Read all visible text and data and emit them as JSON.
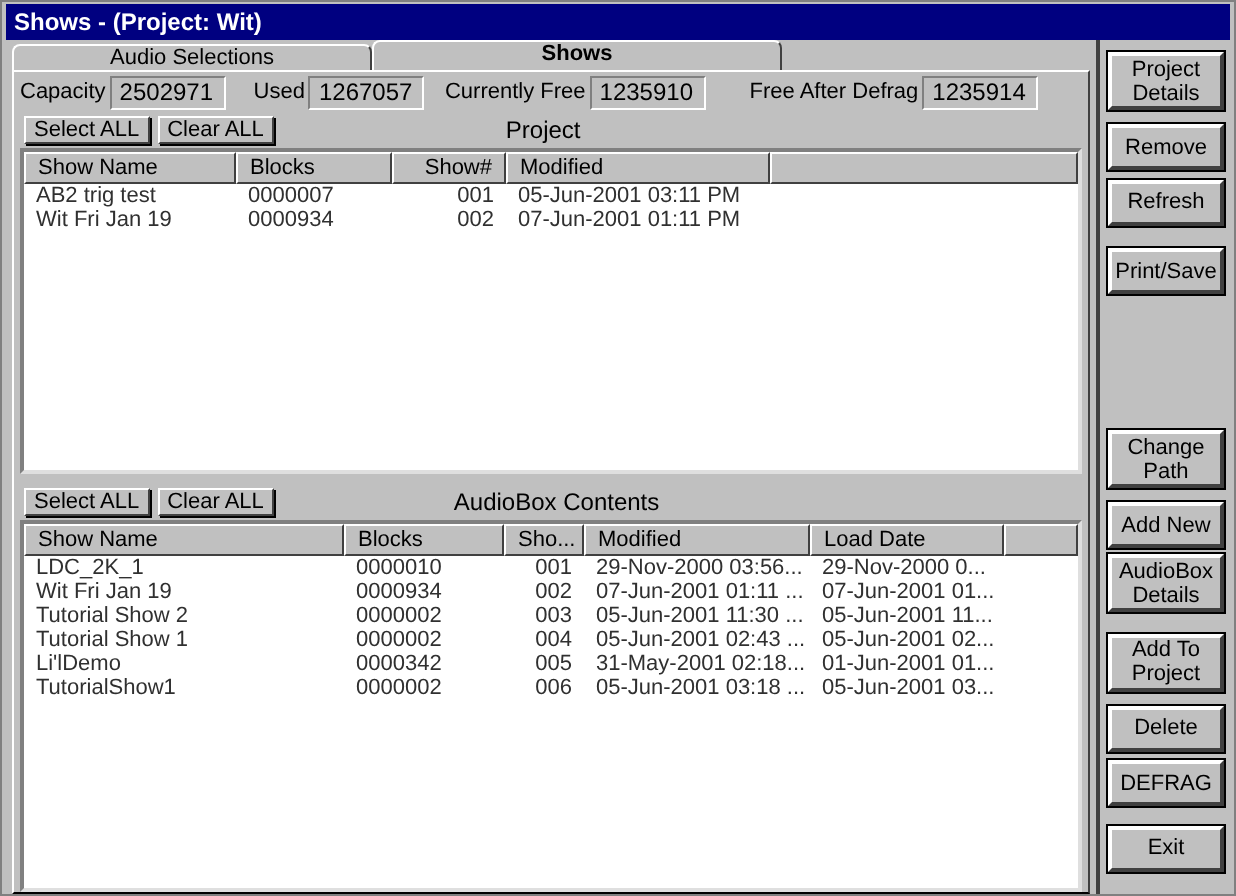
{
  "window": {
    "title": "Shows - (Project: Wit)"
  },
  "tabs": [
    {
      "label": "Audio Selections",
      "selected": false
    },
    {
      "label": "Shows",
      "selected": true
    }
  ],
  "stats": [
    {
      "label": "Capacity",
      "value": "2502971"
    },
    {
      "label": "Used",
      "value": "1267057"
    },
    {
      "label": "Currently Free",
      "value": "1235910"
    },
    {
      "label": "Free After Defrag",
      "value": "1235914"
    }
  ],
  "project": {
    "title": "Project",
    "buttons": [
      "Select ALL",
      "Clear ALL"
    ],
    "columns": [
      "Show Name",
      "Blocks",
      "Show#",
      "Modified"
    ],
    "rows": [
      [
        "AB2 trig test",
        "0000007",
        "001",
        "05-Jun-2001 03:11 PM"
      ],
      [
        "Wit Fri Jan 19",
        "0000934",
        "002",
        "07-Jun-2001 01:11 PM"
      ]
    ]
  },
  "audiobox": {
    "title": "AudioBox Contents",
    "buttons": [
      "Select ALL",
      "Clear ALL"
    ],
    "columns": [
      "Show Name",
      "Blocks",
      "Sho...",
      "Modified",
      "Load Date"
    ],
    "rows": [
      [
        "LDC_2K_1",
        "0000010",
        "001",
        "29-Nov-2000 03:56...",
        "29-Nov-2000 0..."
      ],
      [
        "Wit Fri Jan 19",
        "0000934",
        "002",
        "07-Jun-2001 01:11 ...",
        "07-Jun-2001 01..."
      ],
      [
        "Tutorial Show 2",
        "0000002",
        "003",
        "05-Jun-2001 11:30 ...",
        "05-Jun-2001 11..."
      ],
      [
        "Tutorial Show 1",
        "0000002",
        "004",
        "05-Jun-2001 02:43 ...",
        "05-Jun-2001 02..."
      ],
      [
        "Li'lDemo",
        "0000342",
        "005",
        "31-May-2001 02:18...",
        "01-Jun-2001 01..."
      ],
      [
        "TutorialShow1",
        "0000002",
        "006",
        "05-Jun-2001 03:18 ...",
        "05-Jun-2001 03..."
      ]
    ]
  },
  "side_buttons": [
    {
      "label": "Project Details",
      "kind": "tall"
    },
    {
      "label": "Remove",
      "kind": "short"
    },
    {
      "label": "Refresh",
      "kind": "short"
    },
    {
      "label": "Print/Save",
      "kind": "short"
    },
    {
      "label": "Change Path",
      "kind": "tall"
    },
    {
      "label": "Add  New",
      "kind": "short"
    },
    {
      "label": "AudioBox Details",
      "kind": "tall"
    },
    {
      "label": "Add To Project",
      "kind": "tall"
    },
    {
      "label": "Delete",
      "kind": "short"
    },
    {
      "label": "DEFRAG",
      "kind": "short"
    },
    {
      "label": "Exit",
      "kind": "short"
    }
  ]
}
